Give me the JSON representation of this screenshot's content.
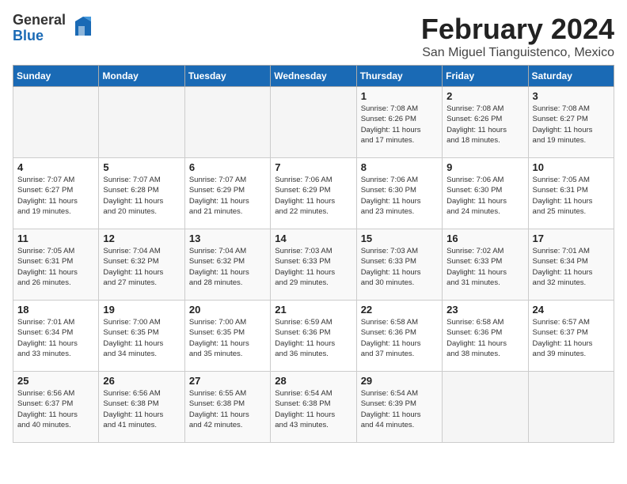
{
  "header": {
    "logo_general": "General",
    "logo_blue": "Blue",
    "month_title": "February 2024",
    "location": "San Miguel Tianguistenco, Mexico"
  },
  "weekdays": [
    "Sunday",
    "Monday",
    "Tuesday",
    "Wednesday",
    "Thursday",
    "Friday",
    "Saturday"
  ],
  "weeks": [
    [
      {
        "day": "",
        "info": ""
      },
      {
        "day": "",
        "info": ""
      },
      {
        "day": "",
        "info": ""
      },
      {
        "day": "",
        "info": ""
      },
      {
        "day": "1",
        "info": "Sunrise: 7:08 AM\nSunset: 6:26 PM\nDaylight: 11 hours\nand 17 minutes."
      },
      {
        "day": "2",
        "info": "Sunrise: 7:08 AM\nSunset: 6:26 PM\nDaylight: 11 hours\nand 18 minutes."
      },
      {
        "day": "3",
        "info": "Sunrise: 7:08 AM\nSunset: 6:27 PM\nDaylight: 11 hours\nand 19 minutes."
      }
    ],
    [
      {
        "day": "4",
        "info": "Sunrise: 7:07 AM\nSunset: 6:27 PM\nDaylight: 11 hours\nand 19 minutes."
      },
      {
        "day": "5",
        "info": "Sunrise: 7:07 AM\nSunset: 6:28 PM\nDaylight: 11 hours\nand 20 minutes."
      },
      {
        "day": "6",
        "info": "Sunrise: 7:07 AM\nSunset: 6:29 PM\nDaylight: 11 hours\nand 21 minutes."
      },
      {
        "day": "7",
        "info": "Sunrise: 7:06 AM\nSunset: 6:29 PM\nDaylight: 11 hours\nand 22 minutes."
      },
      {
        "day": "8",
        "info": "Sunrise: 7:06 AM\nSunset: 6:30 PM\nDaylight: 11 hours\nand 23 minutes."
      },
      {
        "day": "9",
        "info": "Sunrise: 7:06 AM\nSunset: 6:30 PM\nDaylight: 11 hours\nand 24 minutes."
      },
      {
        "day": "10",
        "info": "Sunrise: 7:05 AM\nSunset: 6:31 PM\nDaylight: 11 hours\nand 25 minutes."
      }
    ],
    [
      {
        "day": "11",
        "info": "Sunrise: 7:05 AM\nSunset: 6:31 PM\nDaylight: 11 hours\nand 26 minutes."
      },
      {
        "day": "12",
        "info": "Sunrise: 7:04 AM\nSunset: 6:32 PM\nDaylight: 11 hours\nand 27 minutes."
      },
      {
        "day": "13",
        "info": "Sunrise: 7:04 AM\nSunset: 6:32 PM\nDaylight: 11 hours\nand 28 minutes."
      },
      {
        "day": "14",
        "info": "Sunrise: 7:03 AM\nSunset: 6:33 PM\nDaylight: 11 hours\nand 29 minutes."
      },
      {
        "day": "15",
        "info": "Sunrise: 7:03 AM\nSunset: 6:33 PM\nDaylight: 11 hours\nand 30 minutes."
      },
      {
        "day": "16",
        "info": "Sunrise: 7:02 AM\nSunset: 6:33 PM\nDaylight: 11 hours\nand 31 minutes."
      },
      {
        "day": "17",
        "info": "Sunrise: 7:01 AM\nSunset: 6:34 PM\nDaylight: 11 hours\nand 32 minutes."
      }
    ],
    [
      {
        "day": "18",
        "info": "Sunrise: 7:01 AM\nSunset: 6:34 PM\nDaylight: 11 hours\nand 33 minutes."
      },
      {
        "day": "19",
        "info": "Sunrise: 7:00 AM\nSunset: 6:35 PM\nDaylight: 11 hours\nand 34 minutes."
      },
      {
        "day": "20",
        "info": "Sunrise: 7:00 AM\nSunset: 6:35 PM\nDaylight: 11 hours\nand 35 minutes."
      },
      {
        "day": "21",
        "info": "Sunrise: 6:59 AM\nSunset: 6:36 PM\nDaylight: 11 hours\nand 36 minutes."
      },
      {
        "day": "22",
        "info": "Sunrise: 6:58 AM\nSunset: 6:36 PM\nDaylight: 11 hours\nand 37 minutes."
      },
      {
        "day": "23",
        "info": "Sunrise: 6:58 AM\nSunset: 6:36 PM\nDaylight: 11 hours\nand 38 minutes."
      },
      {
        "day": "24",
        "info": "Sunrise: 6:57 AM\nSunset: 6:37 PM\nDaylight: 11 hours\nand 39 minutes."
      }
    ],
    [
      {
        "day": "25",
        "info": "Sunrise: 6:56 AM\nSunset: 6:37 PM\nDaylight: 11 hours\nand 40 minutes."
      },
      {
        "day": "26",
        "info": "Sunrise: 6:56 AM\nSunset: 6:38 PM\nDaylight: 11 hours\nand 41 minutes."
      },
      {
        "day": "27",
        "info": "Sunrise: 6:55 AM\nSunset: 6:38 PM\nDaylight: 11 hours\nand 42 minutes."
      },
      {
        "day": "28",
        "info": "Sunrise: 6:54 AM\nSunset: 6:38 PM\nDaylight: 11 hours\nand 43 minutes."
      },
      {
        "day": "29",
        "info": "Sunrise: 6:54 AM\nSunset: 6:39 PM\nDaylight: 11 hours\nand 44 minutes."
      },
      {
        "day": "",
        "info": ""
      },
      {
        "day": "",
        "info": ""
      }
    ]
  ]
}
